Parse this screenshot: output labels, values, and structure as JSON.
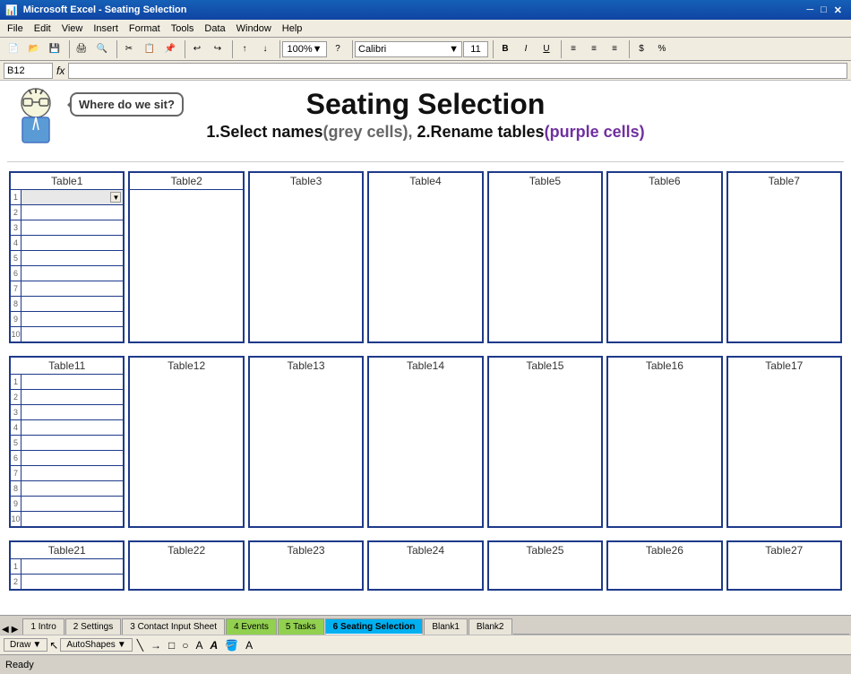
{
  "app": {
    "title": "Microsoft Excel - Seating Selection",
    "cell_ref": "B12",
    "formula_content": ""
  },
  "menu": {
    "items": [
      "File",
      "Edit",
      "View",
      "Insert",
      "Format",
      "Tools",
      "Data",
      "Window",
      "Help"
    ]
  },
  "toolbar": {
    "zoom": "100%",
    "font": "Calibri",
    "font_size": "11",
    "bold": "B",
    "italic": "I",
    "underline": "U"
  },
  "header": {
    "speech_bubble": "Where do we sit?",
    "main_title": "Seating Selection",
    "sub_title_part1": "1.Select names",
    "sub_title_part1_suffix": "(grey cells),",
    "sub_title_part2": "  2.Rename tables",
    "sub_title_part2_suffix": "(purple cells)"
  },
  "tables": {
    "row1": [
      "Table1",
      "Table2",
      "Table3",
      "Table4",
      "Table5",
      "Table6",
      "Table7"
    ],
    "row2": [
      "Table11",
      "Table12",
      "Table13",
      "Table14",
      "Table15",
      "Table16",
      "Table17"
    ],
    "row3": [
      "Table21",
      "Table22",
      "Table23",
      "Table24",
      "Table25",
      "Table26",
      "Table27"
    ]
  },
  "tabs": [
    {
      "label": "1 Intro",
      "type": "normal"
    },
    {
      "label": "2 Settings",
      "type": "normal"
    },
    {
      "label": "3 Contact Input Sheet",
      "type": "normal"
    },
    {
      "label": "4 Events",
      "type": "green"
    },
    {
      "label": "5 Tasks",
      "type": "green"
    },
    {
      "label": "6 Seating Selection",
      "type": "blue"
    },
    {
      "label": "Blank1",
      "type": "normal"
    },
    {
      "label": "Blank2",
      "type": "normal"
    }
  ],
  "status": {
    "left": "Ready",
    "right": ""
  },
  "draw_tools": {
    "draw_label": "Draw",
    "autoshapes_label": "AutoShapes"
  }
}
